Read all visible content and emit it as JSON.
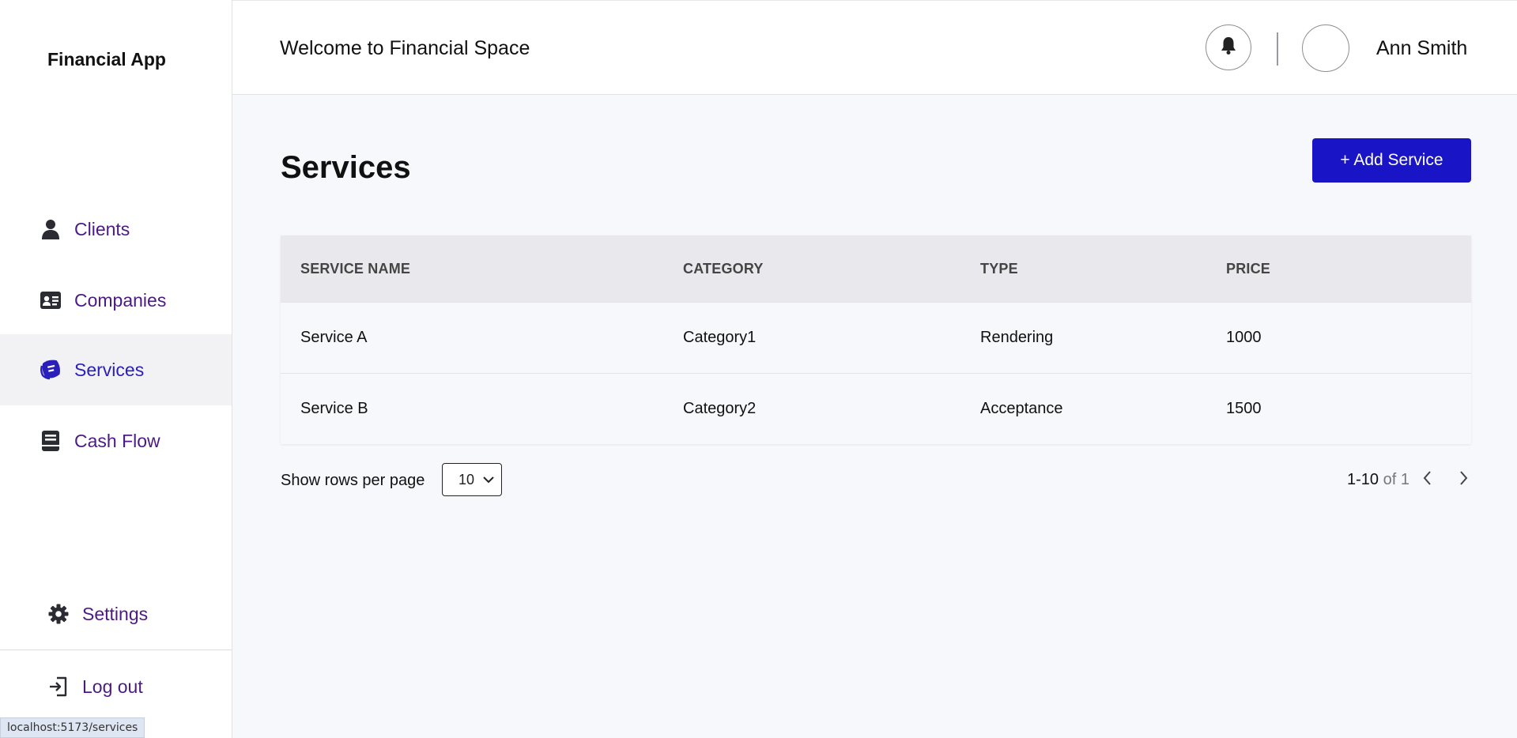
{
  "app": {
    "brand": "Financial App"
  },
  "sidebar": {
    "items": [
      {
        "label": "Clients",
        "icon": "person-icon"
      },
      {
        "label": "Companies",
        "icon": "id-card-icon"
      },
      {
        "label": "Services",
        "icon": "services-icon",
        "active": true
      },
      {
        "label": "Cash Flow",
        "icon": "ledger-icon"
      }
    ],
    "settings_label": "Settings",
    "logout_label": "Log out"
  },
  "header": {
    "title": "Welcome to Financial Space",
    "user_name": "Ann Smith"
  },
  "main": {
    "title": "Services",
    "add_button_label": "+ Add Service",
    "table": {
      "columns": [
        "SERVICE NAME",
        "CATEGORY",
        "TYPE",
        "PRICE"
      ],
      "rows": [
        [
          "Service A",
          "Category1",
          "Rendering",
          "1000"
        ],
        [
          "Service B",
          "Category2",
          "Acceptance",
          "1500"
        ]
      ]
    },
    "pagination": {
      "rows_per_page_label": "Show rows per page",
      "rows_per_page_value": "10",
      "range": "1-10",
      "of_label": "of 1"
    }
  },
  "status_bar": {
    "url": "localhost:5173/services"
  },
  "colors": {
    "accent": "#1a14c7",
    "nav_text": "#4b1a84",
    "active_bg": "#f2f2f4",
    "table_header_bg": "#e9e8ec"
  }
}
